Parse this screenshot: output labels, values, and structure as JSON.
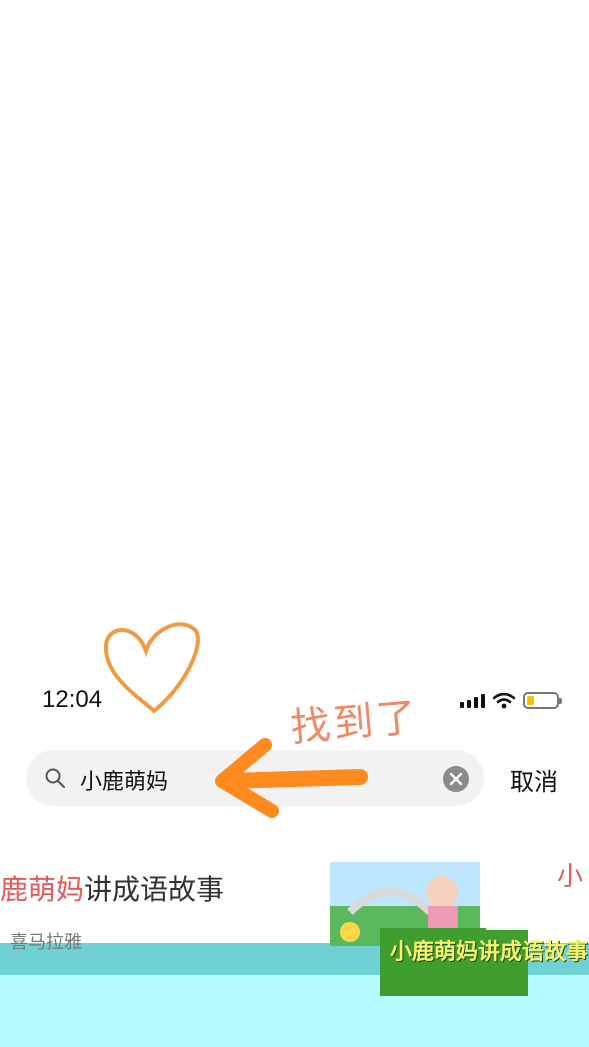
{
  "status_bar": {
    "time": "12:04",
    "signal_icon": "signal-bars-icon",
    "wifi_icon": "wifi-icon",
    "battery_icon": "battery-icon",
    "battery_level": 0.25,
    "battery_color": "#f2c200"
  },
  "annotation": {
    "text": "找到了",
    "color": "#ef8a66"
  },
  "search": {
    "query": "小鹿萌妈",
    "cancel_label": "取消",
    "search_icon": "search-icon",
    "clear_icon": "clear-icon"
  },
  "result": {
    "title_highlight": "鹿萌妈",
    "title_rest": "讲成语故事",
    "subtitle": "喜马拉雅",
    "thumbnail_text": "小鹿萌妈讲成语故事",
    "right_partial": "小",
    "highlight_color": "#e55a5a",
    "band_color": "#6fd1d3",
    "block_color": "#b5fbff"
  }
}
